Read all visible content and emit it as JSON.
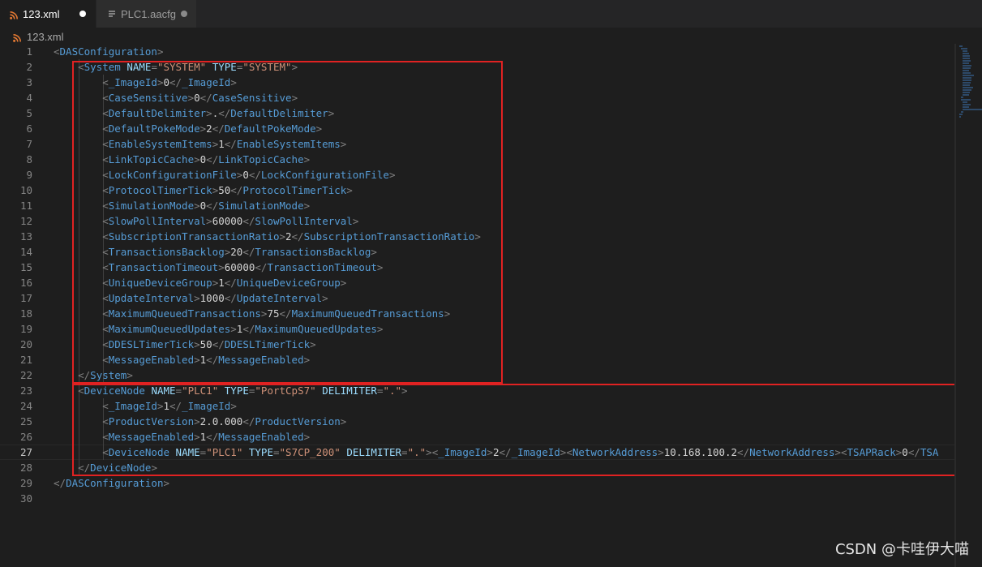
{
  "tabs": [
    {
      "label": "123.xml",
      "icon": "rss-icon",
      "active": true,
      "dirty": true
    },
    {
      "label": "PLC1.aacfg",
      "icon": "file-icon",
      "active": false,
      "dirty": true
    }
  ],
  "breadcrumb": {
    "file": "123.xml",
    "icon": "rss-icon"
  },
  "editor": {
    "current_line": 27,
    "line_numbers": [
      "1",
      "2",
      "3",
      "4",
      "5",
      "6",
      "7",
      "8",
      "9",
      "10",
      "11",
      "12",
      "13",
      "14",
      "15",
      "16",
      "17",
      "18",
      "19",
      "20",
      "21",
      "22",
      "23",
      "24",
      "25",
      "26",
      "27",
      "28",
      "29",
      "30"
    ],
    "lines": [
      "<DASConfiguration>",
      "    <System NAME=\"SYSTEM\" TYPE=\"SYSTEM\">",
      "        <_ImageId>0</_ImageId>",
      "        <CaseSensitive>0</CaseSensitive>",
      "        <DefaultDelimiter>.</DefaultDelimiter>",
      "        <DefaultPokeMode>2</DefaultPokeMode>",
      "        <EnableSystemItems>1</EnableSystemItems>",
      "        <LinkTopicCache>0</LinkTopicCache>",
      "        <LockConfigurationFile>0</LockConfigurationFile>",
      "        <ProtocolTimerTick>50</ProtocolTimerTick>",
      "        <SimulationMode>0</SimulationMode>",
      "        <SlowPollInterval>60000</SlowPollInterval>",
      "        <SubscriptionTransactionRatio>2</SubscriptionTransactionRatio>",
      "        <TransactionsBacklog>20</TransactionsBacklog>",
      "        <TransactionTimeout>60000</TransactionTimeout>",
      "        <UniqueDeviceGroup>1</UniqueDeviceGroup>",
      "        <UpdateInterval>1000</UpdateInterval>",
      "        <MaximumQueuedTransactions>75</MaximumQueuedTransactions>",
      "        <MaximumQueuedUpdates>1</MaximumQueuedUpdates>",
      "        <DDESLTimerTick>50</DDESLTimerTick>",
      "        <MessageEnabled>1</MessageEnabled>",
      "    </System>",
      "    <DeviceNode NAME=\"PLC1\" TYPE=\"PortCpS7\" DELIMITER=\".\">",
      "        <_ImageId>1</_ImageId>",
      "        <ProductVersion>2.0.000</ProductVersion>",
      "        <MessageEnabled>1</MessageEnabled>",
      "        <DeviceNode NAME=\"PLC1\" TYPE=\"S7CP_200\" DELIMITER=\".\"><_ImageId>2</_ImageId><NetworkAddress>10.168.100.2</NetworkAddress><TSAPRack>0</TSA",
      "    </DeviceNode>",
      "</DASConfiguration>",
      ""
    ]
  },
  "annotations": {
    "highlight_color": "#e02222"
  },
  "watermark": "CSDN @卡哇伊大喵"
}
